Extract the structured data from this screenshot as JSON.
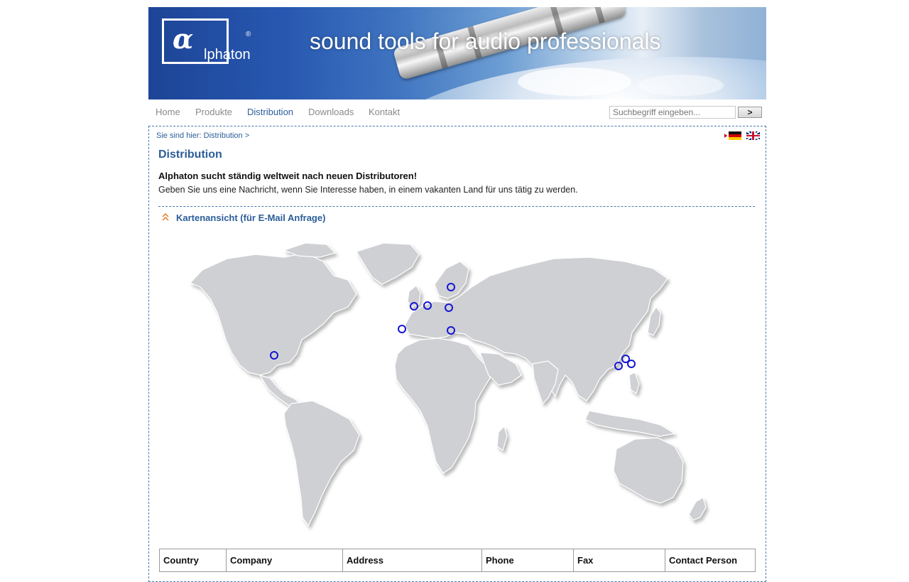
{
  "header": {
    "logo_alpha": "α",
    "logo_word": "lphaton",
    "logo_reg": "®",
    "tagline": "sound tools for audio professionals"
  },
  "nav": {
    "items": [
      {
        "label": "Home",
        "active": false
      },
      {
        "label": "Produkte",
        "active": false
      },
      {
        "label": "Distribution",
        "active": true
      },
      {
        "label": "Downloads",
        "active": false
      },
      {
        "label": "Kontakt",
        "active": false
      }
    ]
  },
  "search": {
    "placeholder": "Suchbegriff eingeben...",
    "button_label": ">"
  },
  "breadcrumb": "Sie sind hier: Distribution >",
  "languages": [
    "de",
    "en"
  ],
  "page": {
    "title": "Distribution",
    "intro_bold": "Alphaton sucht ständig weltweit nach neuen Distributoren!",
    "intro_text": "Geben Sie uns eine Nachricht, wenn Sie Interesse haben, in einem vakanten Land für uns tätig zu werden.",
    "map_heading": "Kartenansicht (für E-Mail Anfrage)"
  },
  "map": {
    "markers": [
      "usa-florida",
      "uk",
      "benelux",
      "sweden",
      "germany-poland",
      "spain-portugal",
      "italy-balkans",
      "china-south",
      "taiwan",
      "philippines"
    ]
  },
  "table": {
    "headers": [
      "Country",
      "Company",
      "Address",
      "Phone",
      "Fax",
      "Contact Person"
    ]
  },
  "colors": {
    "accent": "#2b5d99",
    "marker": "#1515d6",
    "land": "#cfd0d3"
  }
}
